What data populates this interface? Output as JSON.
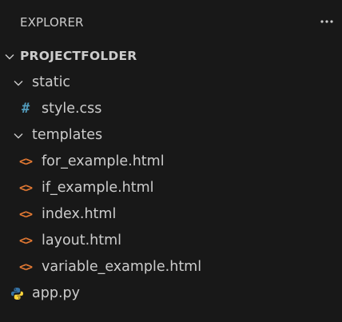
{
  "header": {
    "title": "EXPLORER",
    "more_actions": "..."
  },
  "tree": {
    "root": {
      "label": "PROJECTFOLDER",
      "expanded": true
    },
    "static": {
      "label": "static",
      "expanded": true,
      "files": [
        {
          "label": "style.css",
          "icon": "css-icon",
          "glyph": "#"
        }
      ]
    },
    "templates": {
      "label": "templates",
      "expanded": true,
      "files": [
        {
          "label": "for_example.html",
          "icon": "html-icon",
          "glyph": "<>"
        },
        {
          "label": "if_example.html",
          "icon": "html-icon",
          "glyph": "<>"
        },
        {
          "label": "index.html",
          "icon": "html-icon",
          "glyph": "<>"
        },
        {
          "label": "layout.html",
          "icon": "html-icon",
          "glyph": "<>"
        },
        {
          "label": "variable_example.html",
          "icon": "html-icon",
          "glyph": "<>"
        }
      ]
    },
    "root_files": [
      {
        "label": "app.py",
        "icon": "python-icon"
      }
    ]
  },
  "colors": {
    "background": "#181818",
    "text": "#cccccc",
    "css_icon": "#519aba",
    "html_icon": "#e37933",
    "python_blue": "#3572a5",
    "python_yellow": "#ffd43b"
  }
}
